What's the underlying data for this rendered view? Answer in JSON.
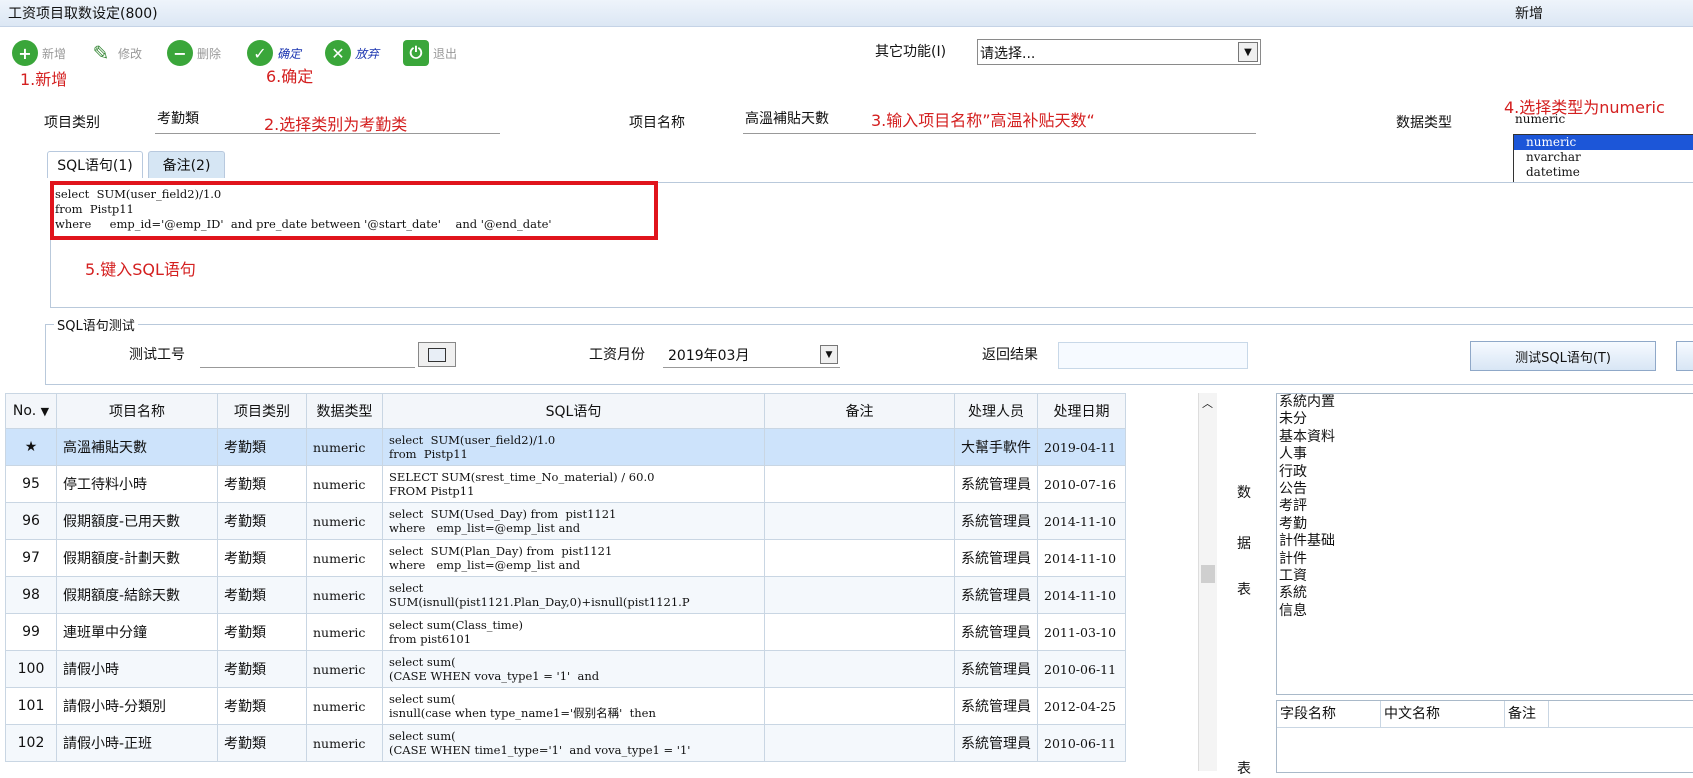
{
  "window": {
    "title": "工资项目取数设定(800)",
    "mode": "新增"
  },
  "toolbar": {
    "buttons": [
      {
        "label": "新增",
        "icon": "plus-icon"
      },
      {
        "label": "修改",
        "icon": "pencil-icon"
      },
      {
        "label": "删除",
        "icon": "minus-icon"
      },
      {
        "label": "确定",
        "icon": "check-icon"
      },
      {
        "label": "放弃",
        "icon": "cross-icon"
      },
      {
        "label": "退出",
        "icon": "exit-icon"
      }
    ],
    "other_label": "其它功能(I)",
    "other_value": "请选择..."
  },
  "annotations": {
    "a1": "1.新增",
    "a2": "2.选择类别为考勤类",
    "a3": "3.输入项目名称”高温补贴天数“",
    "a4": "4.选择类型为numeric",
    "a5": "5.键入SQL语句",
    "a6": "6.确定"
  },
  "form": {
    "category_label": "项目类别",
    "category_value": "考勤類",
    "name_label": "项目名称",
    "name_value": "高溫補貼天數",
    "type_label": "数据类型",
    "type_input": "numeric",
    "type_options": [
      "numeric",
      "nvarchar",
      "datetime"
    ]
  },
  "tabs": {
    "sql": "SQL语句(1)",
    "note": "备注(2)"
  },
  "sql_text": [
    "select  SUM(user_field2)/1.0",
    "from  Pistp11",
    "where     emp_id='@emp_ID'  and pre_date between '@start_date'    and '@end_date'"
  ],
  "test": {
    "legend": "SQL语句测试",
    "emp_label": "测试工号",
    "emp_value": "",
    "month_label": "工资月份",
    "month_value": "2019年03月",
    "result_label": "返回结果",
    "result_value": "",
    "test_button": "测试SQL语句(T)"
  },
  "grid": {
    "headers": [
      "No.",
      "项目名称",
      "项目类别",
      "数据类型",
      "SQL语句",
      "备注",
      "处理人员",
      "处理日期"
    ],
    "rows": [
      {
        "no": "★",
        "name": "高溫補貼天數",
        "cat": "考勤類",
        "type": "numeric",
        "sql": "select  SUM(user_field2)/1.0\nfrom  Pistp11",
        "note": "",
        "user": "大幫手軟件",
        "date": "2019-04-11"
      },
      {
        "no": "95",
        "name": "停工待料小時",
        "cat": "考勤類",
        "type": "numeric",
        "sql": "SELECT SUM(srest_time_No_material) / 60.0\nFROM Pistp11",
        "note": "",
        "user": "系統管理員",
        "date": "2010-07-16"
      },
      {
        "no": "96",
        "name": "假期額度-已用天數",
        "cat": "考勤類",
        "type": "numeric",
        "sql": "select  SUM(Used_Day) from  pist1121\nwhere   emp_list=@emp_list and",
        "note": "",
        "user": "系統管理員",
        "date": "2014-11-10"
      },
      {
        "no": "97",
        "name": "假期額度-計劃天數",
        "cat": "考勤類",
        "type": "numeric",
        "sql": "select  SUM(Plan_Day) from  pist1121\nwhere   emp_list=@emp_list and",
        "note": "",
        "user": "系統管理員",
        "date": "2014-11-10"
      },
      {
        "no": "98",
        "name": "假期額度-結餘天數",
        "cat": "考勤類",
        "type": "numeric",
        "sql": "select\nSUM(isnull(pist1121.Plan_Day,0)+isnull(pist1121.P",
        "note": "",
        "user": "系統管理員",
        "date": "2014-11-10"
      },
      {
        "no": "99",
        "name": "連班單中分鐘",
        "cat": "考勤類",
        "type": "numeric",
        "sql": "select sum(Class_time)\nfrom pist6101",
        "note": "",
        "user": "系統管理員",
        "date": "2011-03-10"
      },
      {
        "no": "100",
        "name": "請假小時",
        "cat": "考勤類",
        "type": "numeric",
        "sql": "select sum(\n(CASE WHEN vova_type1 = '1'  and",
        "note": "",
        "user": "系統管理員",
        "date": "2010-06-11"
      },
      {
        "no": "101",
        "name": "請假小時-分類別",
        "cat": "考勤類",
        "type": "numeric",
        "sql": "select sum(\nisnull(case when type_name1='假别名稱'  then",
        "note": "",
        "user": "系統管理員",
        "date": "2012-04-25"
      },
      {
        "no": "102",
        "name": "請假小時-正班",
        "cat": "考勤類",
        "type": "numeric",
        "sql": "select sum(\n(CASE WHEN time1_type='1'  and vova_type1 = '1'",
        "note": "",
        "user": "系統管理員",
        "date": "2010-06-11"
      }
    ]
  },
  "side_label": [
    "数",
    "据",
    "表",
    "表"
  ],
  "db_tree": [
    "系統内置",
    "未分",
    "基本資料",
    "人事",
    "行政",
    "公告",
    "考評",
    "考勤",
    "計件基础",
    "計件",
    "工資",
    "系統",
    "信息"
  ],
  "fields": {
    "headers": [
      "字段名称",
      "中文名称",
      "备注"
    ]
  },
  "colors": {
    "annotation": "#d42020",
    "highlight_box": "#e0141c",
    "selected_row": "#cde3fb",
    "dropdown_highlight": "#1c56d8"
  }
}
